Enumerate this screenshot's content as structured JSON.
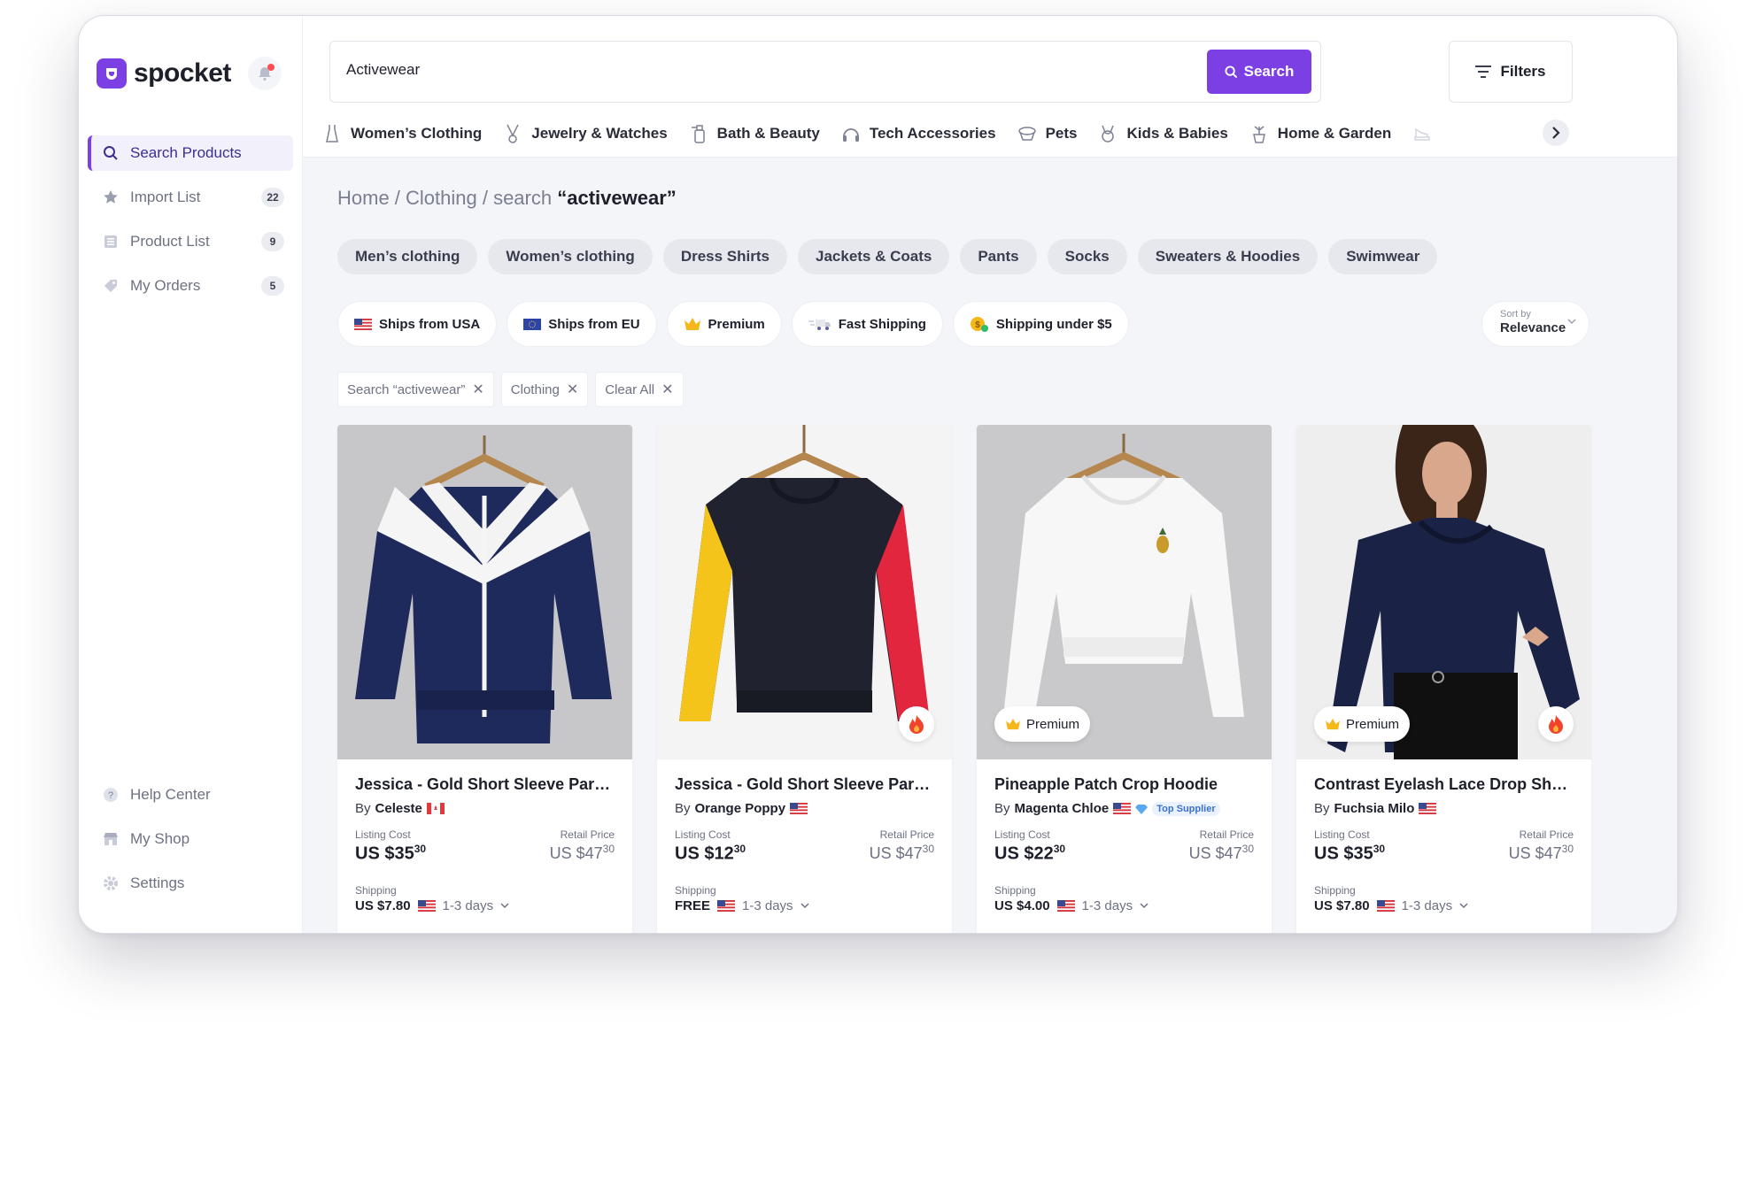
{
  "app": {
    "name": "spocket"
  },
  "nav": {
    "items": [
      {
        "label": "Search Products",
        "badge": ""
      },
      {
        "label": "Import List",
        "badge": "22"
      },
      {
        "label": "Product List",
        "badge": "9"
      },
      {
        "label": "My Orders",
        "badge": "5"
      }
    ],
    "bottom": [
      {
        "label": "Help Center"
      },
      {
        "label": "My Shop"
      },
      {
        "label": "Settings"
      }
    ]
  },
  "search": {
    "value": "Activewear",
    "button": "Search",
    "filters": "Filters"
  },
  "categories": [
    "Women’s Clothing",
    "Jewelry & Watches",
    "Bath & Beauty",
    "Tech Accessories",
    "Pets",
    "Kids & Babies",
    "Home & Garden"
  ],
  "breadcrumb": {
    "path": "Home / Clothing / search ",
    "query": "“activewear”"
  },
  "chips": [
    "Men’s clothing",
    "Women’s clothing",
    "Dress Shirts",
    "Jackets & Coats",
    "Pants",
    "Socks",
    "Sweaters & Hoodies",
    "Swimwear"
  ],
  "pills": [
    "Ships from USA",
    "Ships from EU",
    "Premium",
    "Fast Shipping",
    "Shipping under $5"
  ],
  "sort": {
    "label": "Sort by",
    "value": "Relevance"
  },
  "tags": [
    "Search “activewear”",
    "Clothing",
    "Clear All"
  ],
  "labels": {
    "listing": "Listing Cost",
    "retail": "Retail Price",
    "shipping": "Shipping",
    "by": "By",
    "premium": "Premium",
    "top_supplier": "Top Supplier"
  },
  "products": [
    {
      "name": "Jessica - Gold Short Sleeve Party...",
      "supplier": "Celeste",
      "cost": "US $35",
      "cost_cents": "30",
      "retail": "US $47",
      "retail_cents": "30",
      "shipping": "US $7.80",
      "days": "1-3 days"
    },
    {
      "name": "Jessica - Gold Short Sleeve Party...",
      "supplier": "Orange Poppy",
      "cost": "US $12",
      "cost_cents": "30",
      "retail": "US $47",
      "retail_cents": "30",
      "shipping": "FREE",
      "days": "1-3 days"
    },
    {
      "name": "Pineapple Patch Crop Hoodie",
      "supplier": "Magenta Chloe",
      "cost": "US $22",
      "cost_cents": "30",
      "retail": "US $47",
      "retail_cents": "30",
      "shipping": "US $4.00",
      "days": "1-3 days"
    },
    {
      "name": "Contrast Eyelash Lace Drop Sho...",
      "supplier": "Fuchsia Milo",
      "cost": "US $35",
      "cost_cents": "30",
      "retail": "US $47",
      "retail_cents": "30",
      "shipping": "US $7.80",
      "days": "1-3 days"
    }
  ],
  "colors": {
    "accent": "#7b3fe4"
  }
}
